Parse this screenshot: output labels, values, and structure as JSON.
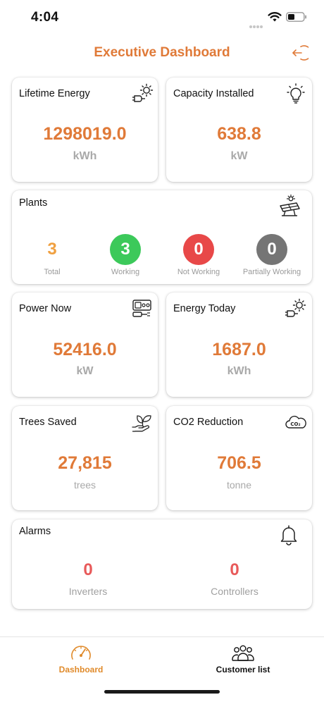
{
  "status_bar": {
    "time": "4:04"
  },
  "header": {
    "title": "Executive Dashboard"
  },
  "cards": {
    "lifetime_energy": {
      "title": "Lifetime Energy",
      "value": "1298019.0",
      "unit": "kWh",
      "icon": "solar-plug-icon"
    },
    "capacity_installed": {
      "title": "Capacity Installed",
      "value": "638.8",
      "unit": "kW",
      "icon": "lightbulb-icon"
    },
    "power_now": {
      "title": "Power Now",
      "value": "52416.0",
      "unit": "kW",
      "icon": "meter-plug-icon"
    },
    "energy_today": {
      "title": "Energy Today",
      "value": "1687.0",
      "unit": "kWh",
      "icon": "solar-plug-icon"
    },
    "trees_saved": {
      "title": "Trees Saved",
      "value": "27,815",
      "unit": "trees",
      "icon": "plant-hand-icon"
    },
    "co2_reduction": {
      "title": "CO2 Reduction",
      "value": "706.5",
      "unit": "tonne",
      "icon": "co2-cloud-icon"
    }
  },
  "plants": {
    "title": "Plants",
    "icon": "solar-panel-icon",
    "stats": [
      {
        "value": "3",
        "label": "Total",
        "color": "#f0a040"
      },
      {
        "value": "3",
        "label": "Working",
        "color": "#3cc95a"
      },
      {
        "value": "0",
        "label": "Not Working",
        "color": "#e84848"
      },
      {
        "value": "0",
        "label": "Partially Working",
        "color": "#757575"
      }
    ]
  },
  "alarms": {
    "title": "Alarms",
    "icon": "bell-icon",
    "items": [
      {
        "value": "0",
        "label": "Inverters"
      },
      {
        "value": "0",
        "label": "Controllers"
      }
    ]
  },
  "tab_bar": {
    "tabs": [
      {
        "label": "Dashboard",
        "icon": "speedometer-icon",
        "active": true,
        "color": "#e08a2a"
      },
      {
        "label": "Customer list",
        "icon": "users-icon",
        "active": false,
        "color": "#111111"
      }
    ]
  },
  "colors": {
    "accent": "#e07a38",
    "unit_gray": "#a9a9a9"
  }
}
